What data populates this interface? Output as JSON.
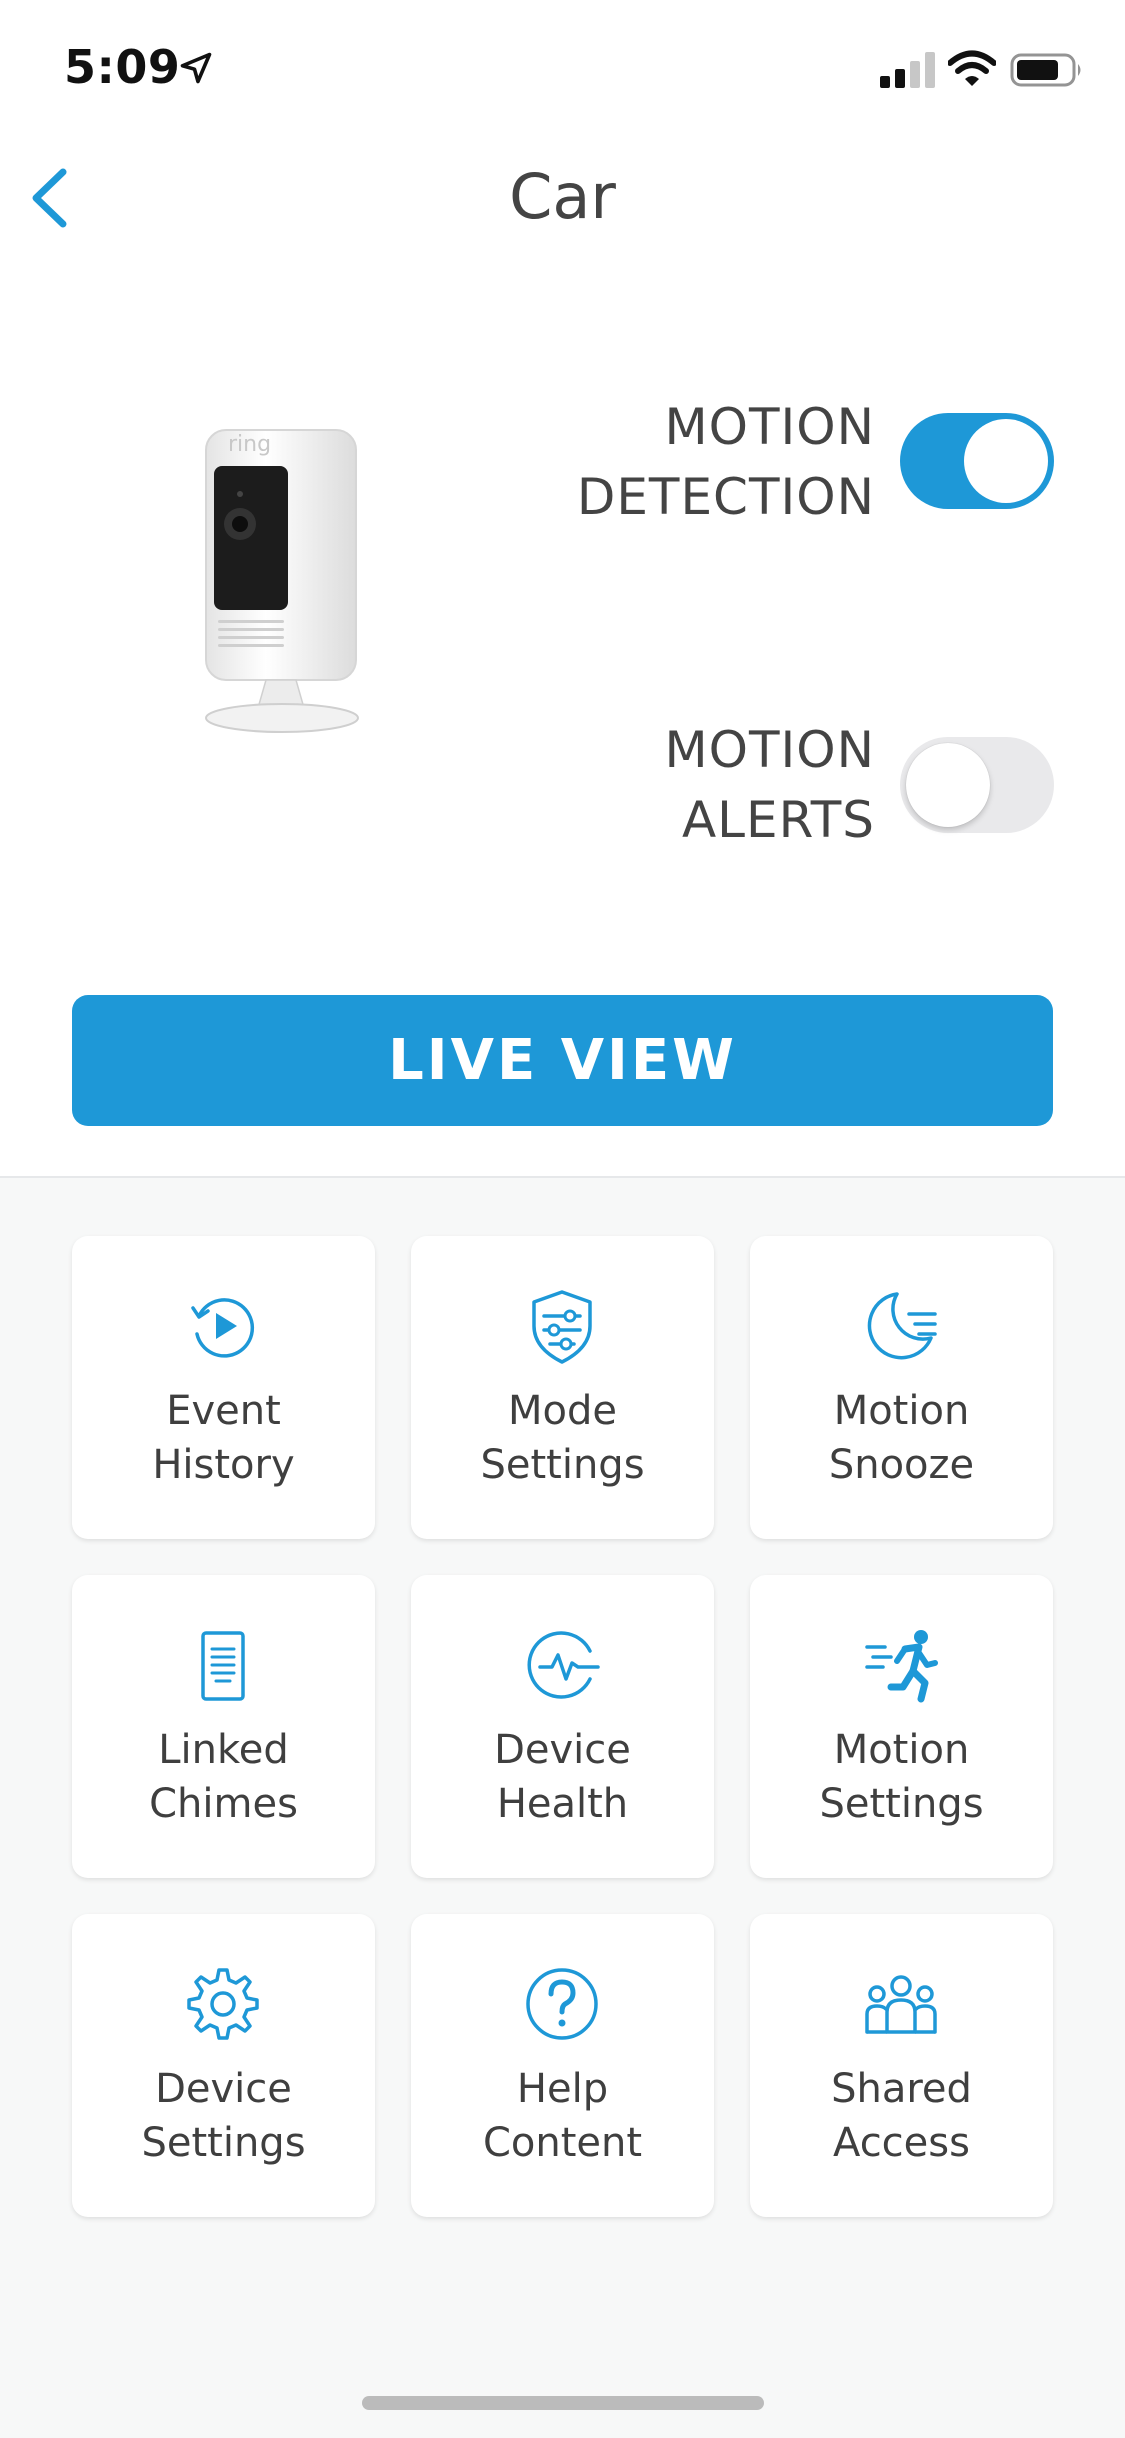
{
  "status_bar": {
    "time": "5:09",
    "icons": [
      "location-arrow-icon",
      "cellular-signal-icon",
      "wifi-icon",
      "battery-icon"
    ]
  },
  "header": {
    "title": "Car",
    "back_icon": "chevron-left-icon"
  },
  "device": {
    "image": "stick-up-camera",
    "brand_mark": "ring"
  },
  "toggles": [
    {
      "line1": "MOTION",
      "line2": "DETECTION",
      "state": "on"
    },
    {
      "line1": "MOTION",
      "line2": "ALERTS",
      "state": "off"
    }
  ],
  "live_view": {
    "label": "LIVE VIEW"
  },
  "tiles": [
    {
      "line1": "Event",
      "line2": "History",
      "icon": "history-play-icon"
    },
    {
      "line1": "Mode",
      "line2": "Settings",
      "icon": "shield-sliders-icon"
    },
    {
      "line1": "Motion",
      "line2": "Snooze",
      "icon": "moon-icon"
    },
    {
      "line1": "Linked",
      "line2": "Chimes",
      "icon": "chime-icon"
    },
    {
      "line1": "Device",
      "line2": "Health",
      "icon": "heartbeat-icon"
    },
    {
      "line1": "Motion",
      "line2": "Settings",
      "icon": "running-person-icon"
    },
    {
      "line1": "Device",
      "line2": "Settings",
      "icon": "gear-icon"
    },
    {
      "line1": "Help",
      "line2": "Content",
      "icon": "question-icon"
    },
    {
      "line1": "Shared",
      "line2": "Access",
      "icon": "users-icon"
    }
  ],
  "colors": {
    "accent": "#1e98d7",
    "text": "#444444",
    "grid_background": "#f7f8f8",
    "toggle_off": "#e9e9eb"
  }
}
